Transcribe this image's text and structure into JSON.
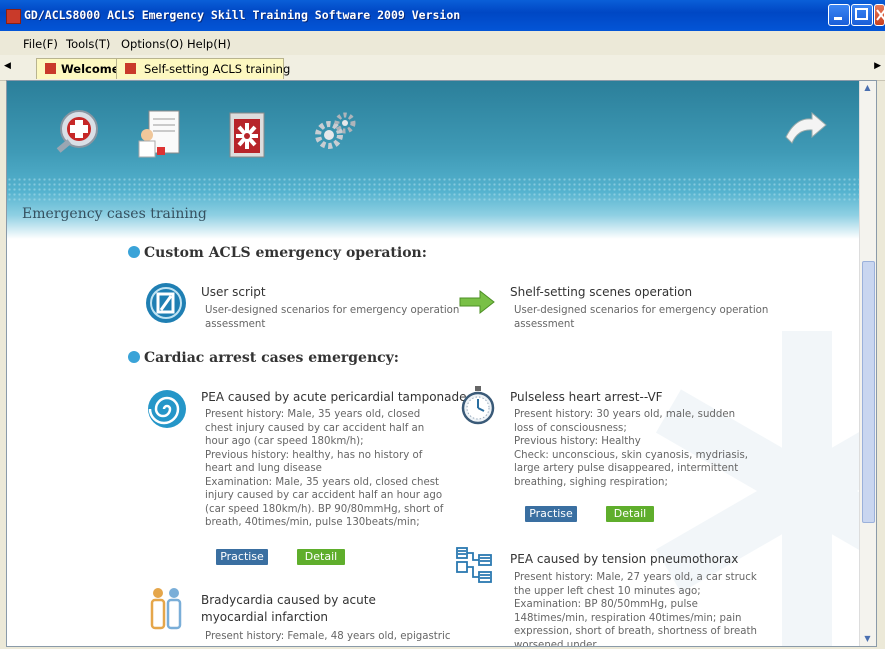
{
  "window": {
    "title": "GD/ACLS8000 ACLS Emergency Skill Training Software 2009 Version"
  },
  "menu": [
    "File(F)",
    "Tools(T)",
    "Options(O)",
    "Help(H)"
  ],
  "tabs": [
    "Welcome",
    "Self-setting ACLS training"
  ],
  "section_label": "Emergency cases training",
  "headings": {
    "custom": "Custom ACLS emergency operation:",
    "cardiac": "Cardiac arrest cases emergency:"
  },
  "custom_items": [
    {
      "title": "User script",
      "desc": "User-designed scenarios for emergency operation assessment"
    },
    {
      "title": "Shelf-setting scenes operation",
      "desc": "User-designed scenarios for emergency operation assessment"
    }
  ],
  "cases": [
    {
      "title": "PEA caused by acute pericardial tamponade",
      "desc": "Present history: Male, 35 years old, closed chest injury caused by car accident half an hour ago (car speed 180km/h);\nPrevious history: healthy, has no history of heart and lung disease\nExamination: Male, 35 years old, closed chest injury caused by car accident half an hour ago (car speed 180km/h). BP 90/80mmHg, short of breath, 40times/min, pulse 130beats/min;"
    },
    {
      "title": "Pulseless heart arrest--VF",
      "desc": "Present history: 30 years old, male, sudden loss of consciousness;\nPrevious history: Healthy\nCheck: unconscious, skin cyanosis, mydriasis, large artery pulse disappeared, intermittent breathing, sighing respiration;"
    },
    {
      "title": "PEA caused by tension pneumothorax",
      "desc": "Present history: Male, 27 years old, a car struck the upper left chest 10 minutes ago;\nExamination: BP 80/50mmHg, pulse 148times/min, respiration 40times/min; pain expression, short of breath, shortness of breath worsened under"
    },
    {
      "title": "Bradycardia caused by acute myocardial infarction",
      "desc": "Present history: Female, 48 years old, epigastric"
    }
  ],
  "buttons": {
    "practise": "Practise",
    "detail": "Detail"
  },
  "colors": {
    "titlebar": "#0054e3",
    "accent": "#3aa3d8",
    "practise": "#3a6fa1",
    "detail": "#5fae2c"
  }
}
